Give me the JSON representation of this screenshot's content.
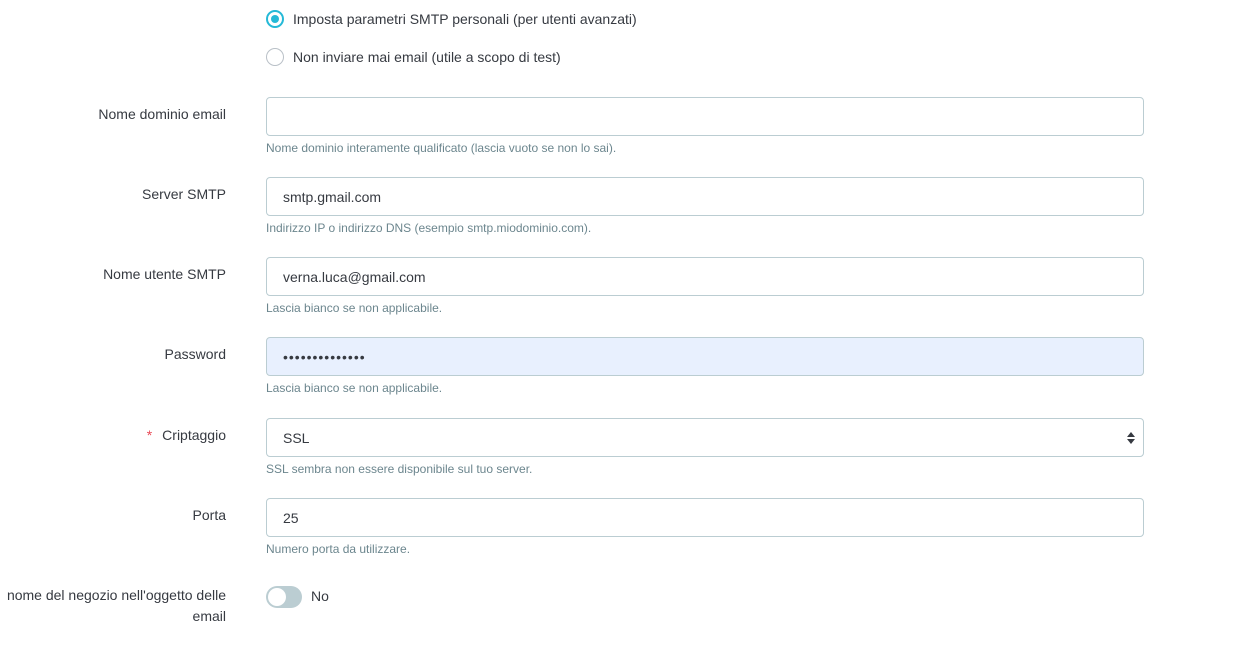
{
  "mail_method": {
    "options": [
      {
        "label": "Imposta parametri SMTP personali (per utenti avanzati)",
        "checked": true
      },
      {
        "label": "Non inviare mai email (utile a scopo di test)",
        "checked": false
      }
    ]
  },
  "fields": {
    "domain": {
      "label": "Nome dominio email",
      "value": "",
      "help": "Nome dominio interamente qualificato (lascia vuoto se non lo sai)."
    },
    "server": {
      "label": "Server SMTP",
      "value": "smtp.gmail.com",
      "help": "Indirizzo IP o indirizzo DNS (esempio smtp.miodominio.com)."
    },
    "username": {
      "label": "Nome utente SMTP",
      "value": "verna.luca@gmail.com",
      "help": "Lascia bianco se non applicabile."
    },
    "password": {
      "label": "Password",
      "value": "••••••••••••••",
      "help": "Lascia bianco se non applicabile."
    },
    "encryption": {
      "label": "Criptaggio",
      "required_mark": "*",
      "value": "SSL",
      "help": "SSL sembra non essere disponibile sul tuo server."
    },
    "port": {
      "label": "Porta",
      "value": "25",
      "help": "Numero porta da utilizzare."
    },
    "shop_name_subject": {
      "label_line1": "nome del negozio nell'oggetto delle",
      "label_line2": "email",
      "value": "No",
      "enabled": false
    }
  },
  "colors": {
    "accent": "#25b9d7",
    "border": "#bbcdd2",
    "help_text": "#6c868e",
    "required": "#e94956",
    "autofill_bg": "#e8f0fe"
  }
}
